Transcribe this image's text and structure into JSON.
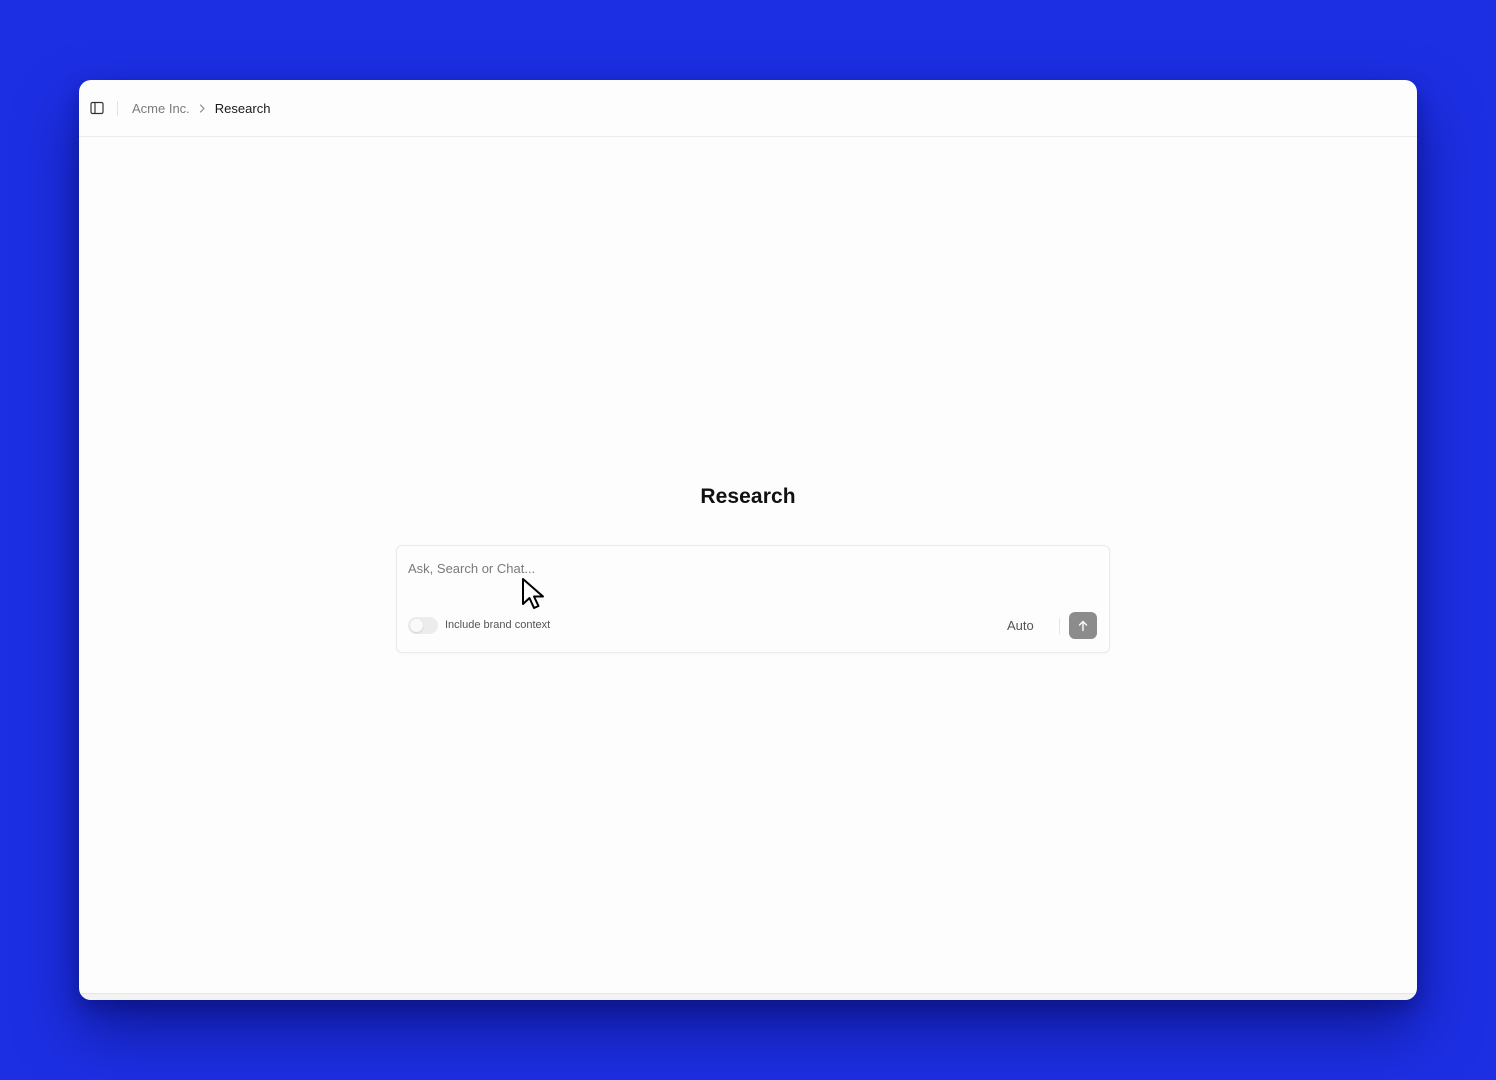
{
  "topbar": {
    "sidebar_toggle_icon": "sidebar-panel-icon",
    "breadcrumb": {
      "parent": "Acme Inc.",
      "separator_icon": "chevron-right-icon",
      "current": "Research"
    }
  },
  "main": {
    "title": "Research",
    "composer": {
      "placeholder": "Ask, Search or Chat...",
      "value": "",
      "toggle": {
        "label": "Include brand context",
        "on": false
      },
      "model": "Auto",
      "send_icon": "arrow-up-icon"
    }
  },
  "colors": {
    "background": "#1d2fe3",
    "window": "#fdfdfd",
    "send_button": "#8c8c8c"
  },
  "cursor_icon": "mouse-pointer-icon"
}
